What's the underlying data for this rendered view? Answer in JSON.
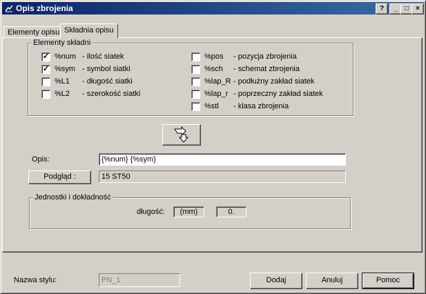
{
  "window": {
    "title": "Opis zbrojenia"
  },
  "title_buttons": {
    "help": "?",
    "minimize": "_",
    "maximize": "□",
    "close": "×"
  },
  "tabs": [
    {
      "label": "Elementy opisu",
      "active": false
    },
    {
      "label": "Składnia opisu",
      "active": true
    }
  ],
  "elements_group": {
    "title": "Elementy składni",
    "left": [
      {
        "code": "%num",
        "desc": "- ilość siatek",
        "checked": true
      },
      {
        "code": "%sym",
        "desc": "- symbol siatki",
        "checked": true
      },
      {
        "code": "%L1",
        "desc": "- długość siatki",
        "checked": false
      },
      {
        "code": "%L2",
        "desc": "- szerokość siatki",
        "checked": false
      }
    ],
    "right": [
      {
        "code": "%pos",
        "desc": "- pozycja zbrojenia",
        "checked": false
      },
      {
        "code": "%sch",
        "desc": "- schemat zbrojenia",
        "checked": false
      },
      {
        "code": "%lap_R",
        "desc": "- podłużny zakład siatek",
        "checked": false
      },
      {
        "code": "%lap_r",
        "desc": "- poprzeczny zakład siatek",
        "checked": false
      },
      {
        "code": "%stl",
        "desc": "- klasa zbrojenia",
        "checked": false
      }
    ]
  },
  "opis": {
    "label": "Opis:",
    "value": "{%num} {%sym}"
  },
  "preview": {
    "button_label": "Podgląd :",
    "value": "15 ST50"
  },
  "units_group": {
    "title": "Jednostki i dokładność",
    "length_label": "długość:",
    "unit_value": "(mm)",
    "precision_value": "0."
  },
  "footer": {
    "style_label": "Nazwa stylu:",
    "style_value": "PN_1",
    "buttons": {
      "add": "Dodaj",
      "cancel": "Anuluj",
      "help": "Pomoc"
    }
  },
  "colors": {
    "titlebar_start": "#0a246a",
    "titlebar_end": "#3a6ea5",
    "face": "#d4d0c8"
  }
}
